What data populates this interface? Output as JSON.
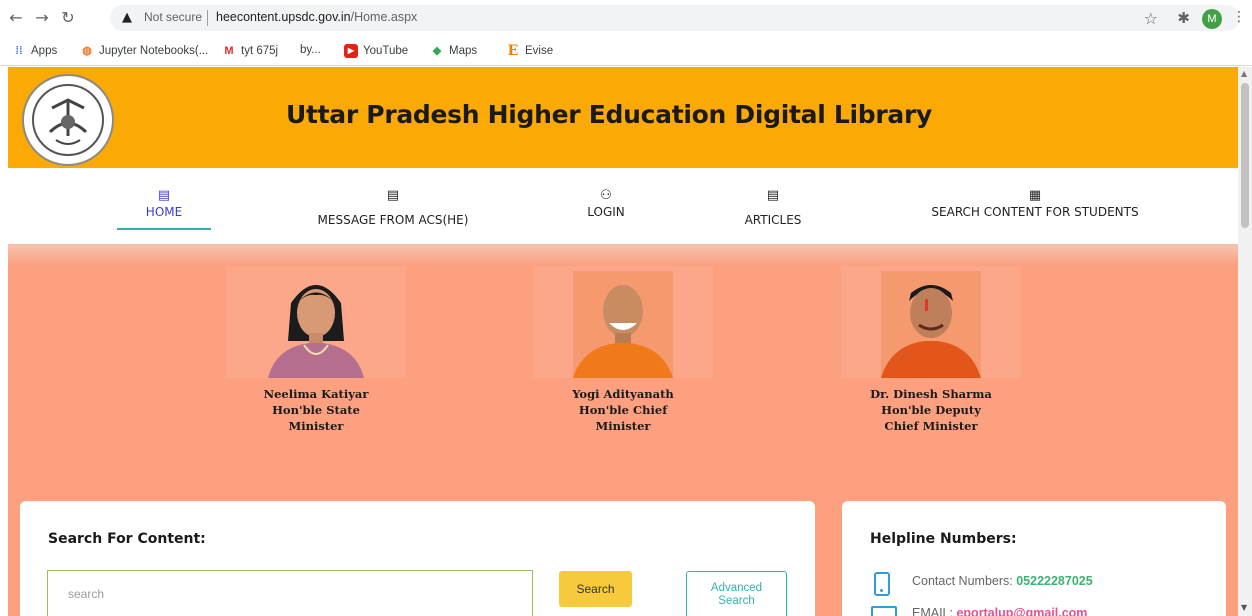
{
  "browser": {
    "security_label": "Not secure",
    "url_host": "heecontent.upsdc.gov.in",
    "url_path": "/Home.aspx",
    "avatar_letter": "M",
    "bookmarks": [
      {
        "label": "Apps",
        "icon": "apps-grid-icon"
      },
      {
        "label": "Jupyter Notebooks(...",
        "icon": "jupyter-icon"
      },
      {
        "label": "tyt 675j",
        "icon": "gmail-icon"
      },
      {
        "label": "by...",
        "icon": "page-icon"
      },
      {
        "label": "YouTube",
        "icon": "youtube-icon"
      },
      {
        "label": "Maps",
        "icon": "maps-icon"
      },
      {
        "label": "Evise",
        "icon": "evise-icon"
      }
    ]
  },
  "header": {
    "title": "Uttar Pradesh Higher Education Digital Library"
  },
  "nav": {
    "items": [
      {
        "label": "HOME",
        "icon": "home-icon",
        "active": true
      },
      {
        "label": "MESSAGE FROM ACS(HE)",
        "icon": "document-icon"
      },
      {
        "label": "LOGIN",
        "icon": "user-icon"
      },
      {
        "label": "ARTICLES",
        "icon": "document-icon"
      },
      {
        "label": "SEARCH CONTENT FOR STUDENTS",
        "icon": "table-icon"
      }
    ]
  },
  "leaders": [
    {
      "name": "Neelima Katiyar",
      "line2": "Hon'ble State",
      "line3": "Minister"
    },
    {
      "name": "Yogi Adityanath",
      "line2": "Hon'ble Chief",
      "line3": "Minister"
    },
    {
      "name": "Dr. Dinesh Sharma",
      "line2": "Hon'ble Deputy",
      "line3": "Chief Minister"
    }
  ],
  "search": {
    "title": "Search For Content:",
    "placeholder": "search",
    "search_label": "Search",
    "advanced_label_1": "Advanced",
    "advanced_label_2": "Search"
  },
  "helpline": {
    "title": "Helpline Numbers:",
    "contact_label": "Contact Numbers: ",
    "contact_number": "05222287025",
    "email_label": "EMAIL: ",
    "email": "eportalup@gmail.com"
  },
  "colors": {
    "banner": "#fba904",
    "hero": "#fca07f",
    "accent_teal": "#2fb3b0",
    "search_button": "#f8c93b",
    "nav_active": "#3b3bdb"
  }
}
